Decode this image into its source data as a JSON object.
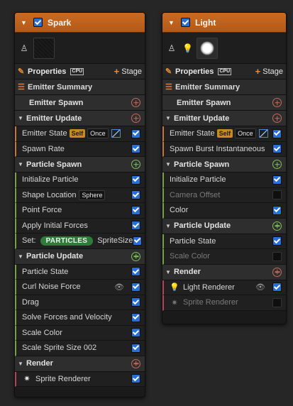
{
  "spark": {
    "title": "Spark",
    "properties_label": "Properties",
    "cpu_label": "CPU",
    "stage_label": "Stage",
    "summary_label": "Emitter Summary",
    "emitter_spawn": "Emitter Spawn",
    "emitter_update": {
      "label": "Emitter Update",
      "items": [
        {
          "label": "Emitter State",
          "self": "Self",
          "once": "Once"
        },
        {
          "label": "Spawn Rate"
        }
      ]
    },
    "particle_spawn": {
      "label": "Particle Spawn",
      "items": [
        {
          "label": "Initialize Particle"
        },
        {
          "label": "Shape Location",
          "chip": "Sphere"
        },
        {
          "label": "Point Force"
        },
        {
          "label": "Apply Initial Forces"
        },
        {
          "label": "Set:",
          "pill": "PARTICLES",
          "extra": "SpriteSize"
        }
      ]
    },
    "particle_update": {
      "label": "Particle Update",
      "items": [
        {
          "label": "Particle State"
        },
        {
          "label": "Curl Noise Force"
        },
        {
          "label": "Drag"
        },
        {
          "label": "Solve Forces and Velocity"
        },
        {
          "label": "Scale Color"
        },
        {
          "label": "Scale Sprite Size 002"
        }
      ]
    },
    "render": {
      "label": "Render",
      "items": [
        {
          "label": "Sprite Renderer"
        }
      ]
    }
  },
  "light": {
    "title": "Light",
    "properties_label": "Properties",
    "cpu_label": "CPU",
    "stage_label": "Stage",
    "summary_label": "Emitter Summary",
    "emitter_spawn": "Emitter Spawn",
    "emitter_update": {
      "label": "Emitter Update",
      "items": [
        {
          "label": "Emitter State",
          "self": "Self",
          "once": "Once"
        },
        {
          "label": "Spawn Burst Instantaneous"
        }
      ]
    },
    "particle_spawn": {
      "label": "Particle Spawn",
      "items": [
        {
          "label": "Initialize Particle"
        },
        {
          "label": "Camera Offset"
        },
        {
          "label": "Color"
        }
      ]
    },
    "particle_update": {
      "label": "Particle Update",
      "items": [
        {
          "label": "Particle State"
        },
        {
          "label": "Scale Color"
        }
      ]
    },
    "render": {
      "label": "Render",
      "items": [
        {
          "label": "Light Renderer"
        },
        {
          "label": "Sprite Renderer"
        }
      ]
    }
  },
  "colors": {
    "header_orange": "#c96a22",
    "checkbox_blue": "#2a6fd6",
    "particles_pill": "#2f7c3a"
  }
}
